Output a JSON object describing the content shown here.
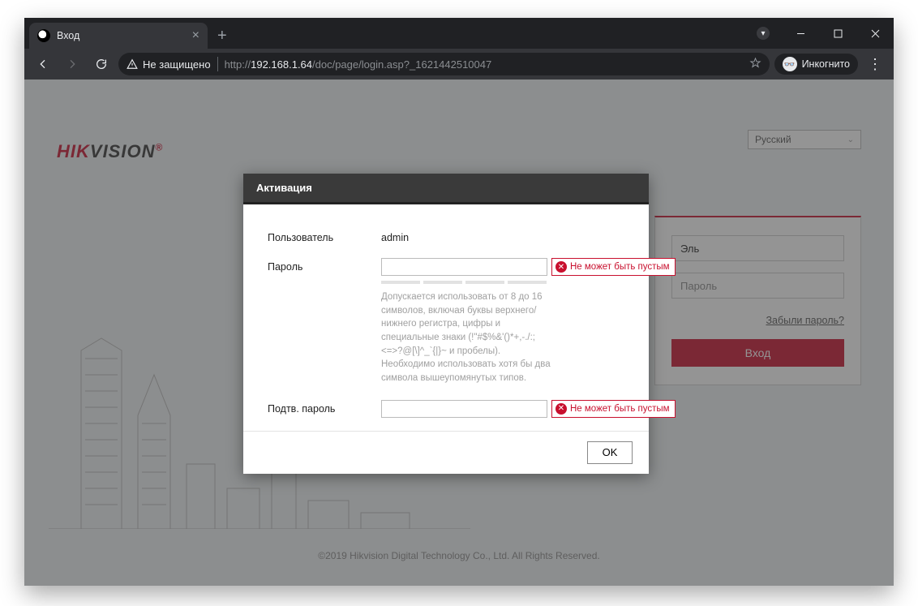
{
  "browser": {
    "tab_title": "Вход",
    "security_label": "Не защищено",
    "url_prefix": "http://",
    "url_host": "192.168.1.64",
    "url_path": "/doc/page/login.asp?_1621442510047",
    "incognito_label": "Инкогнито"
  },
  "page": {
    "brand_red": "HIK",
    "brand_black": "VISION",
    "brand_reg": "®",
    "lang": "Русский",
    "login": {
      "username_value": "Эль",
      "password_placeholder": "Пароль",
      "forgot": "Забыли пароль?",
      "button": "Вход"
    },
    "copyright": "©2019 Hikvision Digital Technology Co., Ltd. All Rights Reserved."
  },
  "modal": {
    "title": "Активация",
    "user_label": "Пользователь",
    "user_value": "admin",
    "password_label": "Пароль",
    "confirm_label": "Подтв. пароль",
    "hint": "Допускается использовать от 8 до 16 символов, включая буквы верхнего/нижнего регистра, цифры и специальные знаки (!\"#$%&'()*+,-./:;<=>?@[\\]^_`{|}~ и пробелы). Необходимо использовать хотя бы два символа вышеупомянутых типов.",
    "error": "Не может быть пустым",
    "ok": "OK"
  }
}
